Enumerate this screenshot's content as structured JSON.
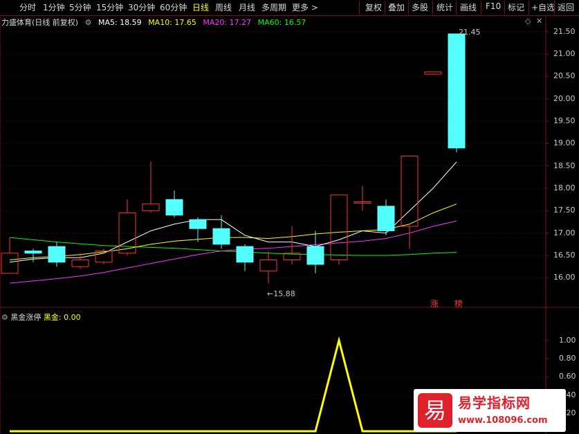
{
  "toolbar": {
    "periods": [
      "分时",
      "1分钟",
      "5分钟",
      "15分钟",
      "30分钟",
      "60分钟",
      "日线",
      "周线",
      "月线",
      "多周期",
      "更多 >"
    ],
    "active_period": "日线",
    "right_buttons": [
      "复权",
      "叠加",
      "多股",
      "统计",
      "画线",
      "F10",
      "标记",
      "+自选",
      "返回"
    ]
  },
  "legend": {
    "stock_name": "力盛体育",
    "mode": "(日线 前复权)",
    "ma5": "MA5: 18.59",
    "ma10": "MA10: 17.65",
    "ma20": "MA20: 17.27",
    "ma60": "MA60: 16.57"
  },
  "indicator": {
    "name": "黑金涨停",
    "value_label": "黑金: 0.00"
  },
  "annotations": {
    "high": "21.45",
    "low": "←15.88",
    "tag1": "涨",
    "tag2": "榜"
  },
  "watermark": {
    "logo_char": "易",
    "title": "易学指标网",
    "url": "www.108096.com"
  },
  "colors": {
    "up": "#ff3232",
    "down": "#54ffff",
    "ma5": "#ffffff",
    "ma10": "#ffff00",
    "ma20": "#ff33ff",
    "ma60": "#00ff00",
    "indicator": "#ffff00",
    "grid": "#7a1414"
  },
  "chart_data": [
    {
      "type": "candlestick",
      "y_ticks": [
        "21.50",
        "21.00",
        "20.50",
        "20.00",
        "19.50",
        "19.00",
        "18.50",
        "18.00",
        "17.50",
        "17.00",
        "16.50",
        "16.00"
      ],
      "ylim": [
        15.65,
        21.65
      ],
      "candles": [
        {
          "o": 16.1,
          "c": 16.55,
          "h": 16.9,
          "l": 16.1
        },
        {
          "o": 16.6,
          "c": 16.55,
          "h": 16.65,
          "l": 16.35
        },
        {
          "o": 16.7,
          "c": 16.35,
          "h": 16.8,
          "l": 16.25
        },
        {
          "o": 16.25,
          "c": 16.4,
          "h": 16.55,
          "l": 16.2
        },
        {
          "o": 16.35,
          "c": 16.6,
          "h": 16.65,
          "l": 16.3
        },
        {
          "o": 16.55,
          "c": 17.45,
          "h": 17.75,
          "l": 16.5
        },
        {
          "o": 17.5,
          "c": 17.65,
          "h": 18.6,
          "l": 17.45
        },
        {
          "o": 17.75,
          "c": 17.4,
          "h": 17.95,
          "l": 17.35
        },
        {
          "o": 17.3,
          "c": 17.1,
          "h": 17.35,
          "l": 16.8
        },
        {
          "o": 17.1,
          "c": 16.75,
          "h": 17.4,
          "l": 16.65
        },
        {
          "o": 16.7,
          "c": 16.35,
          "h": 16.75,
          "l": 16.15
        },
        {
          "o": 16.15,
          "c": 16.4,
          "h": 16.6,
          "l": 15.88
        },
        {
          "o": 16.4,
          "c": 16.55,
          "h": 17.15,
          "l": 16.3
        },
        {
          "o": 16.7,
          "c": 16.3,
          "h": 17.05,
          "l": 16.1
        },
        {
          "o": 16.4,
          "c": 17.85,
          "h": 17.85,
          "l": 16.3
        },
        {
          "o": 17.7,
          "c": 17.7,
          "h": 18.05,
          "l": 17.5
        },
        {
          "o": 17.6,
          "c": 17.05,
          "h": 17.75,
          "l": 16.95
        },
        {
          "o": 17.15,
          "c": 18.72,
          "h": 18.72,
          "l": 16.65
        },
        {
          "o": 20.55,
          "c": 20.6,
          "h": 20.6,
          "l": 20.55
        },
        {
          "o": 21.45,
          "c": 18.9,
          "h": 21.45,
          "l": 18.8
        }
      ],
      "ma5": [
        16.35,
        16.42,
        16.45,
        16.45,
        16.55,
        16.8,
        17.05,
        17.2,
        17.3,
        17.3,
        16.95,
        16.8,
        16.8,
        16.7,
        16.85,
        17.05,
        17.0,
        17.5,
        18.0,
        18.59
      ],
      "ma10": [
        16.4,
        16.45,
        16.48,
        16.52,
        16.58,
        16.65,
        16.75,
        16.82,
        16.86,
        16.9,
        16.9,
        16.88,
        16.92,
        16.98,
        17.02,
        17.05,
        17.08,
        17.2,
        17.45,
        17.65
      ],
      "ma20": [
        15.88,
        15.93,
        15.98,
        16.04,
        16.12,
        16.22,
        16.32,
        16.42,
        16.52,
        16.6,
        16.64,
        16.66,
        16.7,
        16.74,
        16.78,
        16.82,
        16.88,
        17.0,
        17.15,
        17.27
      ],
      "ma60": [
        16.9,
        16.85,
        16.8,
        16.76,
        16.72,
        16.7,
        16.68,
        16.66,
        16.63,
        16.6,
        16.58,
        16.55,
        16.53,
        16.52,
        16.51,
        16.5,
        16.5,
        16.52,
        16.55,
        16.57
      ]
    },
    {
      "type": "line",
      "y_ticks": [
        "1.00",
        "0.80",
        "0.60",
        "0.40",
        "0.20"
      ],
      "ylim": [
        0,
        1.12
      ],
      "values": [
        0,
        0,
        0,
        0,
        0,
        0,
        0,
        0,
        0,
        0,
        0,
        0,
        0,
        0,
        1,
        0,
        0,
        0,
        0,
        0
      ]
    }
  ]
}
